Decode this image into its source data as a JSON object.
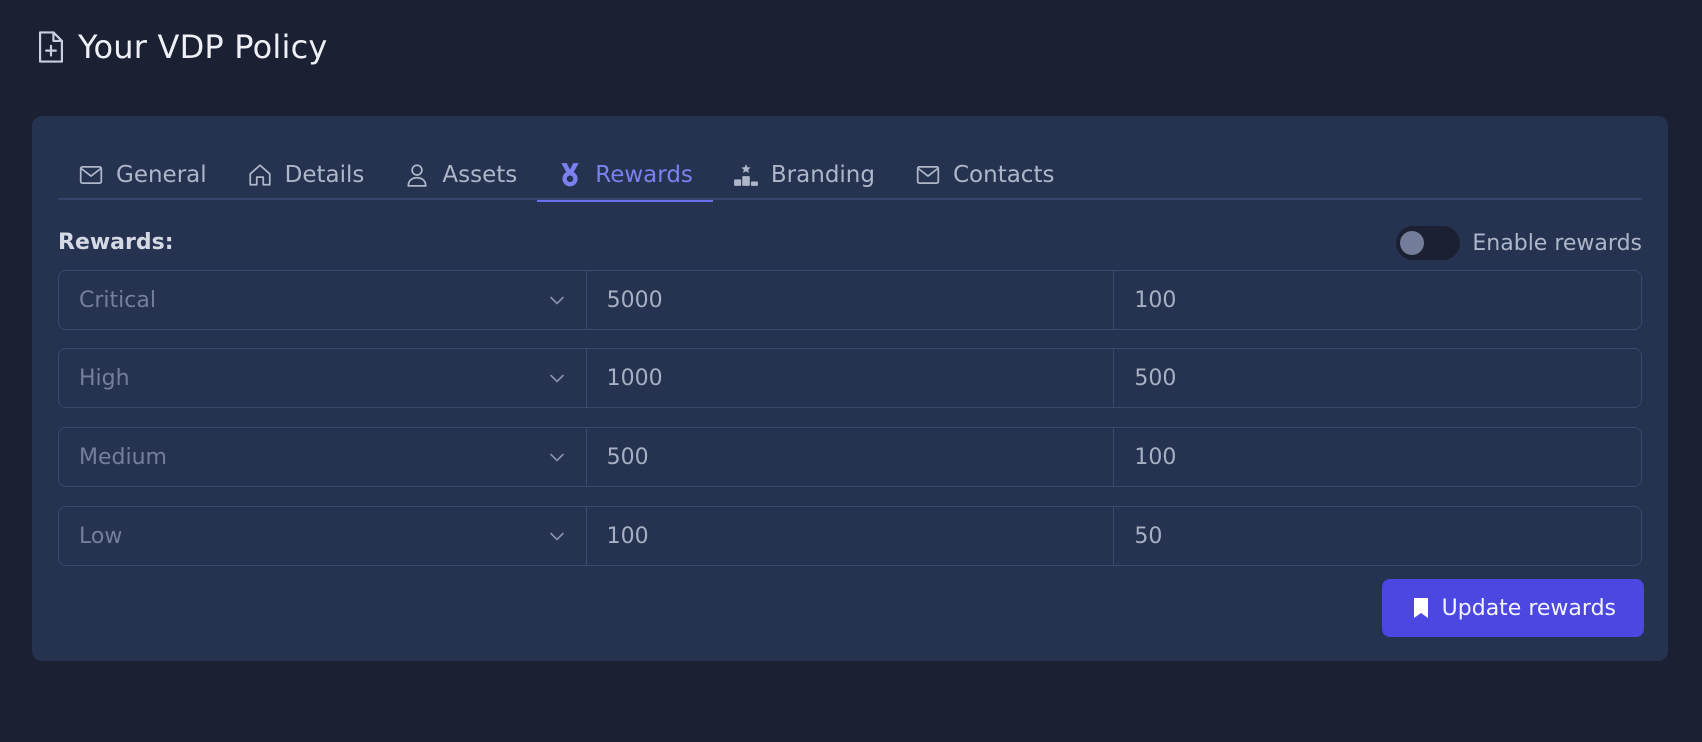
{
  "page": {
    "title": "Your VDP Policy",
    "title_icon": "file-plus-icon"
  },
  "tabs": [
    {
      "label": "General",
      "icon": "mail-icon",
      "active": false
    },
    {
      "label": "Details",
      "icon": "home-icon",
      "active": false
    },
    {
      "label": "Assets",
      "icon": "user-icon",
      "active": false
    },
    {
      "label": "Rewards",
      "icon": "medal-icon",
      "active": true
    },
    {
      "label": "Branding",
      "icon": "podium-icon",
      "active": false
    },
    {
      "label": "Contacts",
      "icon": "mail-icon",
      "active": false
    }
  ],
  "rewards": {
    "section_label": "Rewards:",
    "toggle_label": "Enable rewards",
    "toggle_enabled": false,
    "rows": [
      {
        "severity": "Critical",
        "max": "5000",
        "min": "100"
      },
      {
        "severity": "High",
        "max": "1000",
        "min": "500"
      },
      {
        "severity": "Medium",
        "max": "500",
        "min": "100"
      },
      {
        "severity": "Low",
        "max": "100",
        "min": "50"
      }
    ],
    "submit_label": "Update rewards"
  },
  "colors": {
    "background": "#1b2033",
    "card": "#253250",
    "accent": "#4b47e0",
    "active_tab": "#7b82f0"
  }
}
